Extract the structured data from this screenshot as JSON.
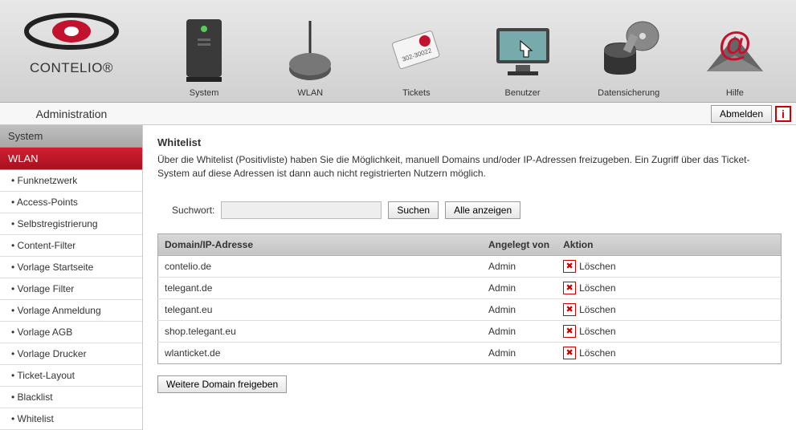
{
  "brand": {
    "name": "CONTELIO®"
  },
  "topnav": [
    {
      "label": "System",
      "icon": "server-icon"
    },
    {
      "label": "WLAN",
      "icon": "antenna-icon"
    },
    {
      "label": "Tickets",
      "icon": "ticket-icon"
    },
    {
      "label": "Benutzer",
      "icon": "monitor-icon"
    },
    {
      "label": "Datensicherung",
      "icon": "backup-icon"
    },
    {
      "label": "Hilfe",
      "icon": "at-icon"
    }
  ],
  "subbar": {
    "left": "Administration",
    "logout": "Abmelden"
  },
  "sidebar": {
    "section1": "System",
    "section2": "WLAN",
    "items": [
      "Funknetzwerk",
      "Access-Points",
      "Selbstregistrierung",
      "Content-Filter",
      "Vorlage Startseite",
      "Vorlage Filter",
      "Vorlage Anmeldung",
      "Vorlage AGB",
      "Vorlage Drucker",
      "Ticket-Layout",
      "Blacklist",
      "Whitelist"
    ]
  },
  "page": {
    "title": "Whitelist",
    "description": "Über die Whitelist (Positivliste) haben Sie die Möglichkeit, manuell Domains und/oder IP-Adressen freizugeben. Ein Zugriff über das Ticket-System auf diese Adressen ist dann auch nicht registrierten Nutzern möglich."
  },
  "search": {
    "label": "Suchwort:",
    "value": "",
    "button_search": "Suchen",
    "button_showall": "Alle anzeigen"
  },
  "table": {
    "headers": {
      "domain": "Domain/IP-Adresse",
      "user": "Angelegt von",
      "action": "Aktion"
    },
    "delete_label": "Löschen",
    "rows": [
      {
        "domain": "contelio.de",
        "user": "Admin"
      },
      {
        "domain": "telegant.de",
        "user": "Admin"
      },
      {
        "domain": "telegant.eu",
        "user": "Admin"
      },
      {
        "domain": "shop.telegant.eu",
        "user": "Admin"
      },
      {
        "domain": "wlanticket.de",
        "user": "Admin"
      }
    ]
  },
  "footer_button": "Weitere Domain freigeben"
}
